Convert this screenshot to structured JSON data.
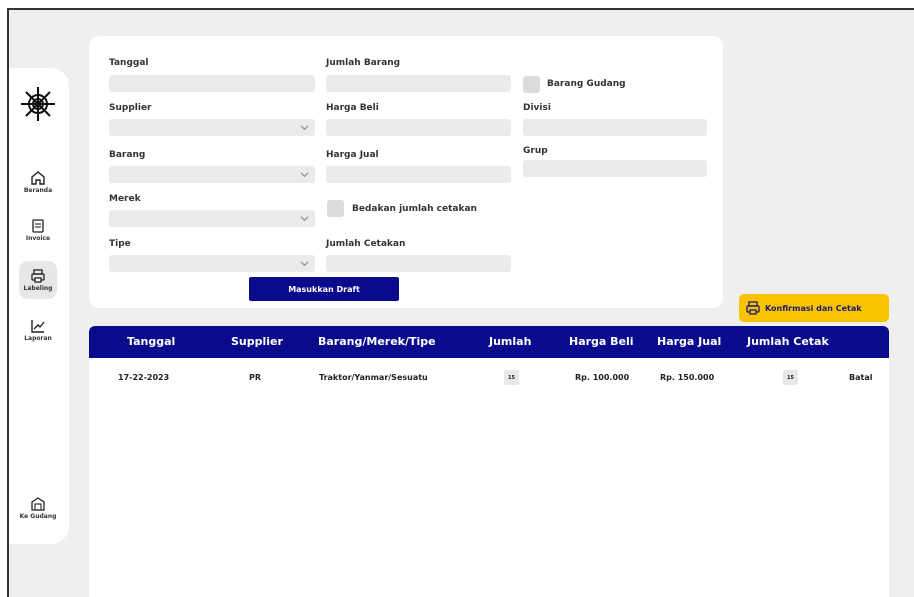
{
  "sidebar": {
    "items": [
      {
        "label": "Beranda",
        "icon": "home-icon"
      },
      {
        "label": "Invoice",
        "icon": "invoice-icon"
      },
      {
        "label": "Labeling",
        "icon": "printer-icon",
        "active": true
      },
      {
        "label": "Laporan",
        "icon": "chart-icon"
      },
      {
        "label": "Ke Gudang",
        "icon": "warehouse-icon"
      }
    ]
  },
  "form": {
    "tanggal_label": "Tanggal",
    "supplier_label": "Supplier",
    "barang_label": "Barang",
    "merek_label": "Merek",
    "tipe_label": "Tipe",
    "jumlah_barang_label": "Jumlah Barang",
    "harga_beli_label": "Harga Beli",
    "harga_jual_label": "Harga Jual",
    "bedakan_label": "Bedakan jumlah cetakan",
    "jumlah_cetakan_label": "Jumlah Cetakan",
    "barang_gudang_label": "Barang Gudang",
    "divisi_label": "Divisi",
    "grup_label": "Grup",
    "submit_label": "Masukkan Draft"
  },
  "confirm_button": "Konfirmasi dan Cetak",
  "table": {
    "headers": [
      "Tanggal",
      "Supplier",
      "Barang/Merek/Tipe",
      "Jumlah",
      "Harga Beli",
      "Harga Jual",
      "Jumlah Cetak"
    ],
    "rows": [
      {
        "tanggal": "17-22-2023",
        "supplier": "PR",
        "barang": "Traktor/Yanmar/Sesuatu",
        "jumlah": "15",
        "harga_beli": "Rp. 100.000",
        "harga_jual": "Rp. 150.000",
        "jumlah_cetak": "15",
        "action": "Batal"
      }
    ]
  },
  "colors": {
    "primary": "#0a0a8c",
    "accent": "#f9c300",
    "background": "#efefef",
    "input": "#ebebeb"
  }
}
